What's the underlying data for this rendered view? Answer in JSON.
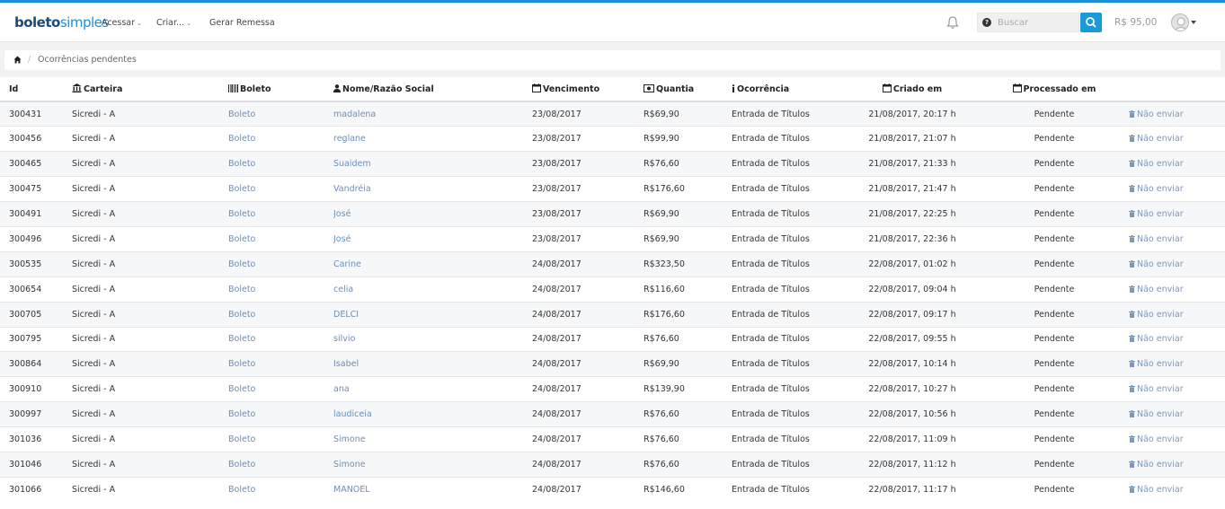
{
  "navbar": {
    "logo_bold": "boleto",
    "logo_light": "simples",
    "menu": [
      "Acessar",
      "Criar...",
      "Gerar Remessa"
    ],
    "search_placeholder": "Buscar",
    "balance": "R$ 95,00"
  },
  "breadcrumb": {
    "current": "Ocorrências pendentes"
  },
  "table": {
    "headers": {
      "id": "Id",
      "carteira": "Carteira",
      "boleto": "Boleto",
      "nome": "Nome/Razão Social",
      "vencimento": "Vencimento",
      "quantia": "Quantia",
      "ocorrencia": "Ocorrência",
      "criado": "Criado em",
      "processado": "Processado em"
    },
    "rows": [
      {
        "id": "300431",
        "carteira": "Sicredi - A",
        "boleto": "Boleto",
        "nome": "madalena",
        "vencimento": "23/08/2017",
        "quantia": "R$69,90",
        "ocorrencia": "Entrada de Títulos",
        "criado": "21/08/2017, 20:17 h",
        "processado": "Pendente",
        "acao": "Não enviar"
      },
      {
        "id": "300456",
        "carteira": "Sicredi - A",
        "boleto": "Boleto",
        "nome": "reglane",
        "vencimento": "23/08/2017",
        "quantia": "R$99,90",
        "ocorrencia": "Entrada de Títulos",
        "criado": "21/08/2017, 21:07 h",
        "processado": "Pendente",
        "acao": "Não enviar"
      },
      {
        "id": "300465",
        "carteira": "Sicredi - A",
        "boleto": "Boleto",
        "nome": "Suaidem",
        "vencimento": "23/08/2017",
        "quantia": "R$76,60",
        "ocorrencia": "Entrada de Títulos",
        "criado": "21/08/2017, 21:33 h",
        "processado": "Pendente",
        "acao": "Não enviar"
      },
      {
        "id": "300475",
        "carteira": "Sicredi - A",
        "boleto": "Boleto",
        "nome": "Vandréia",
        "vencimento": "23/08/2017",
        "quantia": "R$176,60",
        "ocorrencia": "Entrada de Títulos",
        "criado": "21/08/2017, 21:47 h",
        "processado": "Pendente",
        "acao": "Não enviar"
      },
      {
        "id": "300491",
        "carteira": "Sicredi - A",
        "boleto": "Boleto",
        "nome": "José",
        "vencimento": "23/08/2017",
        "quantia": "R$69,90",
        "ocorrencia": "Entrada de Títulos",
        "criado": "21/08/2017, 22:25 h",
        "processado": "Pendente",
        "acao": "Não enviar"
      },
      {
        "id": "300496",
        "carteira": "Sicredi - A",
        "boleto": "Boleto",
        "nome": "José",
        "vencimento": "23/08/2017",
        "quantia": "R$69,90",
        "ocorrencia": "Entrada de Títulos",
        "criado": "21/08/2017, 22:36 h",
        "processado": "Pendente",
        "acao": "Não enviar"
      },
      {
        "id": "300535",
        "carteira": "Sicredi - A",
        "boleto": "Boleto",
        "nome": "Carine",
        "vencimento": "24/08/2017",
        "quantia": "R$323,50",
        "ocorrencia": "Entrada de Títulos",
        "criado": "22/08/2017, 01:02 h",
        "processado": "Pendente",
        "acao": "Não enviar"
      },
      {
        "id": "300654",
        "carteira": "Sicredi - A",
        "boleto": "Boleto",
        "nome": "celia",
        "vencimento": "24/08/2017",
        "quantia": "R$116,60",
        "ocorrencia": "Entrada de Títulos",
        "criado": "22/08/2017, 09:04 h",
        "processado": "Pendente",
        "acao": "Não enviar"
      },
      {
        "id": "300705",
        "carteira": "Sicredi - A",
        "boleto": "Boleto",
        "nome": "DELCI",
        "vencimento": "24/08/2017",
        "quantia": "R$176,60",
        "ocorrencia": "Entrada de Títulos",
        "criado": "22/08/2017, 09:17 h",
        "processado": "Pendente",
        "acao": "Não enviar"
      },
      {
        "id": "300795",
        "carteira": "Sicredi - A",
        "boleto": "Boleto",
        "nome": "silvio",
        "vencimento": "24/08/2017",
        "quantia": "R$76,60",
        "ocorrencia": "Entrada de Títulos",
        "criado": "22/08/2017, 09:55 h",
        "processado": "Pendente",
        "acao": "Não enviar"
      },
      {
        "id": "300864",
        "carteira": "Sicredi - A",
        "boleto": "Boleto",
        "nome": "Isabel",
        "vencimento": "24/08/2017",
        "quantia": "R$69,90",
        "ocorrencia": "Entrada de Títulos",
        "criado": "22/08/2017, 10:14 h",
        "processado": "Pendente",
        "acao": "Não enviar"
      },
      {
        "id": "300910",
        "carteira": "Sicredi - A",
        "boleto": "Boleto",
        "nome": "ana",
        "vencimento": "24/08/2017",
        "quantia": "R$139,90",
        "ocorrencia": "Entrada de Títulos",
        "criado": "22/08/2017, 10:27 h",
        "processado": "Pendente",
        "acao": "Não enviar"
      },
      {
        "id": "300997",
        "carteira": "Sicredi - A",
        "boleto": "Boleto",
        "nome": "laudiceia",
        "vencimento": "24/08/2017",
        "quantia": "R$76,60",
        "ocorrencia": "Entrada de Títulos",
        "criado": "22/08/2017, 10:56 h",
        "processado": "Pendente",
        "acao": "Não enviar"
      },
      {
        "id": "301036",
        "carteira": "Sicredi - A",
        "boleto": "Boleto",
        "nome": "Simone",
        "vencimento": "24/08/2017",
        "quantia": "R$76,60",
        "ocorrencia": "Entrada de Títulos",
        "criado": "22/08/2017, 11:09 h",
        "processado": "Pendente",
        "acao": "Não enviar"
      },
      {
        "id": "301046",
        "carteira": "Sicredi - A",
        "boleto": "Boleto",
        "nome": "Simone",
        "vencimento": "24/08/2017",
        "quantia": "R$76,60",
        "ocorrencia": "Entrada de Títulos",
        "criado": "22/08/2017, 11:12 h",
        "processado": "Pendente",
        "acao": "Não enviar"
      },
      {
        "id": "301066",
        "carteira": "Sicredi - A",
        "boleto": "Boleto",
        "nome": "MANOEL",
        "vencimento": "24/08/2017",
        "quantia": "R$146,60",
        "ocorrencia": "Entrada de Títulos",
        "criado": "22/08/2017, 11:17 h",
        "processado": "Pendente",
        "acao": "Não enviar"
      }
    ]
  },
  "colors": {
    "accent": "#1a8fd8",
    "logo_dark": "#1a4a7a",
    "link": "#6b8fb6"
  },
  "icons": {
    "carteira": "bank-icon",
    "boleto": "barcode-icon",
    "nome": "user-icon",
    "vencimento": "calendar-icon",
    "quantia": "money-icon",
    "ocorrencia": "info-icon",
    "criado": "calendar-icon",
    "processado": "calendar-icon",
    "acao": "trash-icon"
  }
}
